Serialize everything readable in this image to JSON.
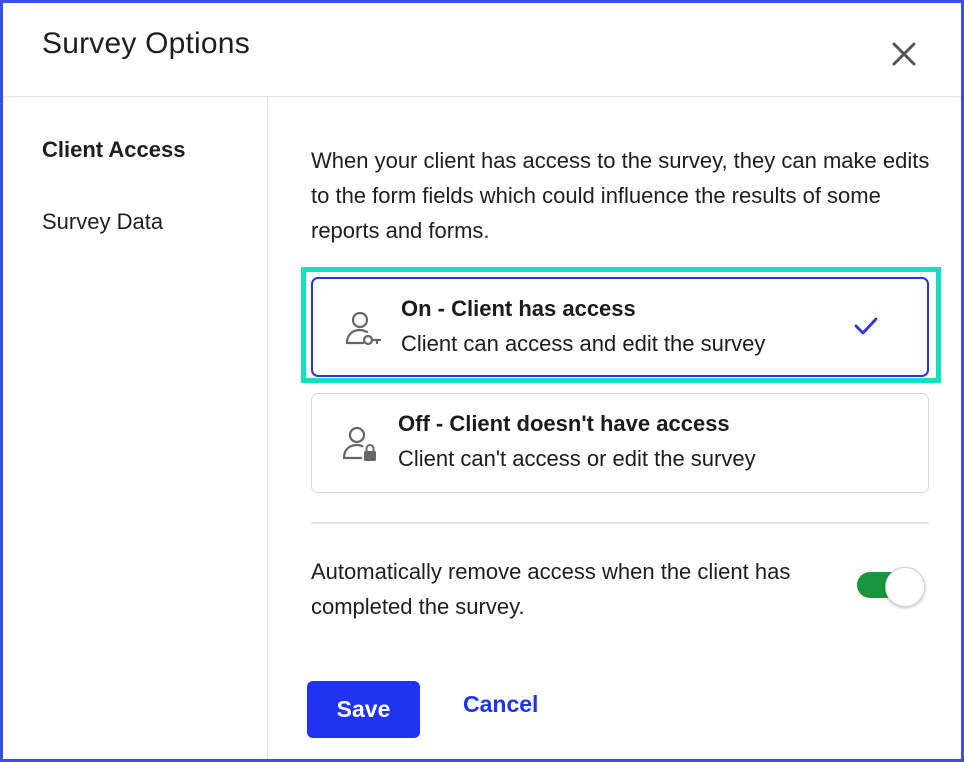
{
  "dialog": {
    "title": "Survey Options",
    "close_icon": "close-icon"
  },
  "sidebar": {
    "items": [
      {
        "label": "Client Access",
        "active": true
      },
      {
        "label": "Survey Data",
        "active": false
      }
    ]
  },
  "client_access": {
    "description": "When your client has access to the survey, they can make edits to the form fields which could influence the results of some reports and forms.",
    "options": [
      {
        "title": "On - Client has access",
        "subtitle": "Client can access and edit the survey",
        "icon": "user-key-icon",
        "selected": true
      },
      {
        "title": "Off - Client doesn't have access",
        "subtitle": "Client can't access or edit the survey",
        "icon": "user-lock-icon",
        "selected": false
      }
    ],
    "auto_remove": {
      "label": "Automatically remove access when the client has completed the survey.",
      "enabled": true
    }
  },
  "footer": {
    "save_label": "Save",
    "cancel_label": "Cancel"
  },
  "colors": {
    "accent": "#1f33f0",
    "highlight": "#14e0c0",
    "toggle_on": "#1b9440"
  }
}
